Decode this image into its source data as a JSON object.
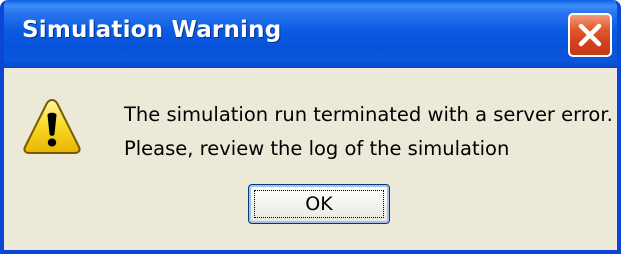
{
  "window": {
    "title": "Simulation Warning",
    "close_icon": "close-icon"
  },
  "dialog": {
    "icon": "warning-icon",
    "message_lines": [
      "The simulation run terminated with a server error.",
      "Please, review the log of the simulation"
    ],
    "ok_label": "OK"
  },
  "colors": {
    "titlebar": "#0a5be0",
    "border": "#0a47d6",
    "close_button": "#d2401b",
    "dialog_background": "#ece9d8",
    "warning_yellow": "#f6d21a"
  }
}
